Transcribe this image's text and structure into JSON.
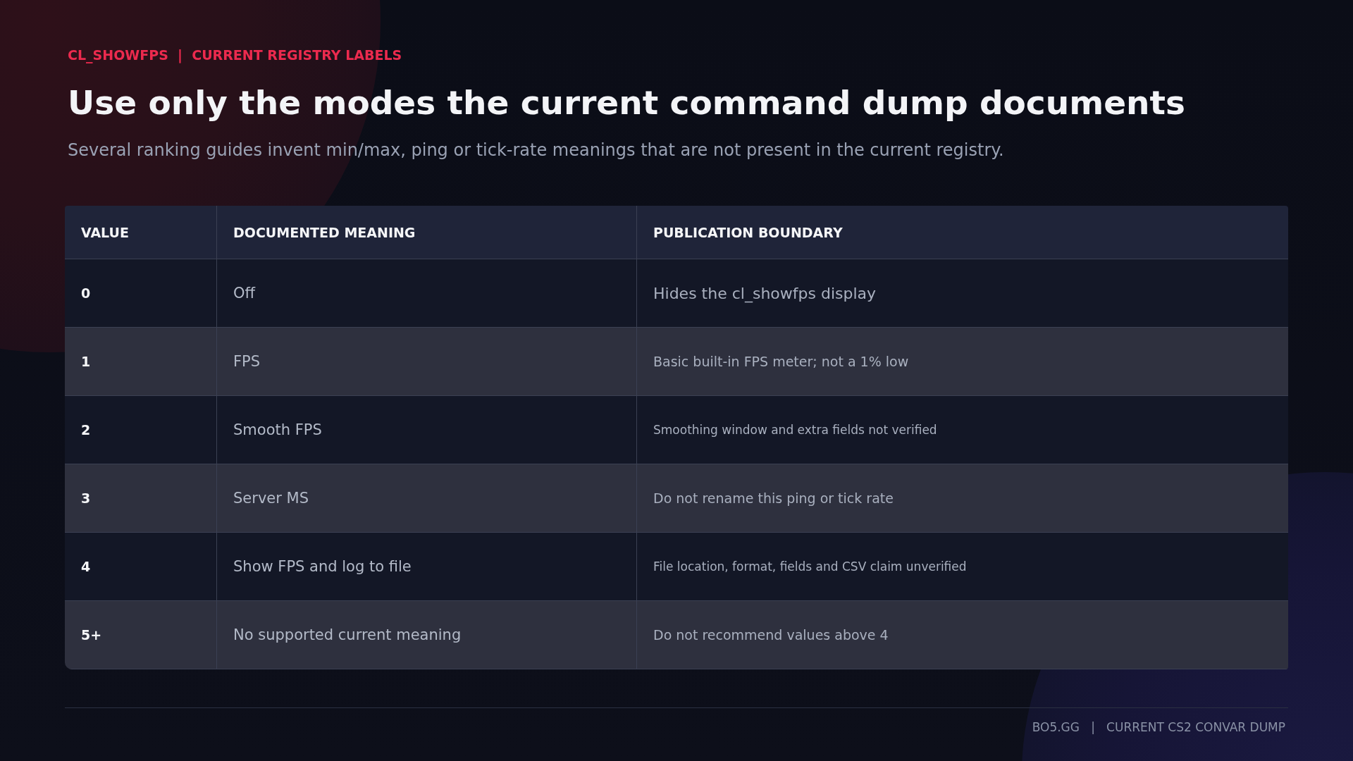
{
  "eyebrow": "CL_SHOWFPS  |  CURRENT REGISTRY LABELS",
  "title": "Use only the modes the current command dump documents",
  "subtitle": "Several ranking guides invent min/max, ping or tick-rate meanings that are not present in the current registry.",
  "table": {
    "columns": [
      "VALUE",
      "DOCUMENTED MEANING",
      "PUBLICATION BOUNDARY"
    ],
    "rows": [
      {
        "value": "0",
        "meaning": "Off",
        "boundary": "Hides the cl_showfps display"
      },
      {
        "value": "1",
        "meaning": "FPS",
        "boundary": "Basic built-in FPS meter; not a 1% low"
      },
      {
        "value": "2",
        "meaning": "Smooth FPS",
        "boundary": "Smoothing window and extra fields not verified"
      },
      {
        "value": "3",
        "meaning": "Server MS",
        "boundary": "Do not rename this ping or tick rate"
      },
      {
        "value": "4",
        "meaning": "Show FPS and log to file",
        "boundary": "File location, format, fields and CSV claim unverified"
      },
      {
        "value": "5+",
        "meaning": "No supported current meaning",
        "boundary": "Do not recommend values above 4"
      }
    ]
  },
  "footer": "BO5.GG   |   CURRENT CS2 CONVAR DUMP"
}
